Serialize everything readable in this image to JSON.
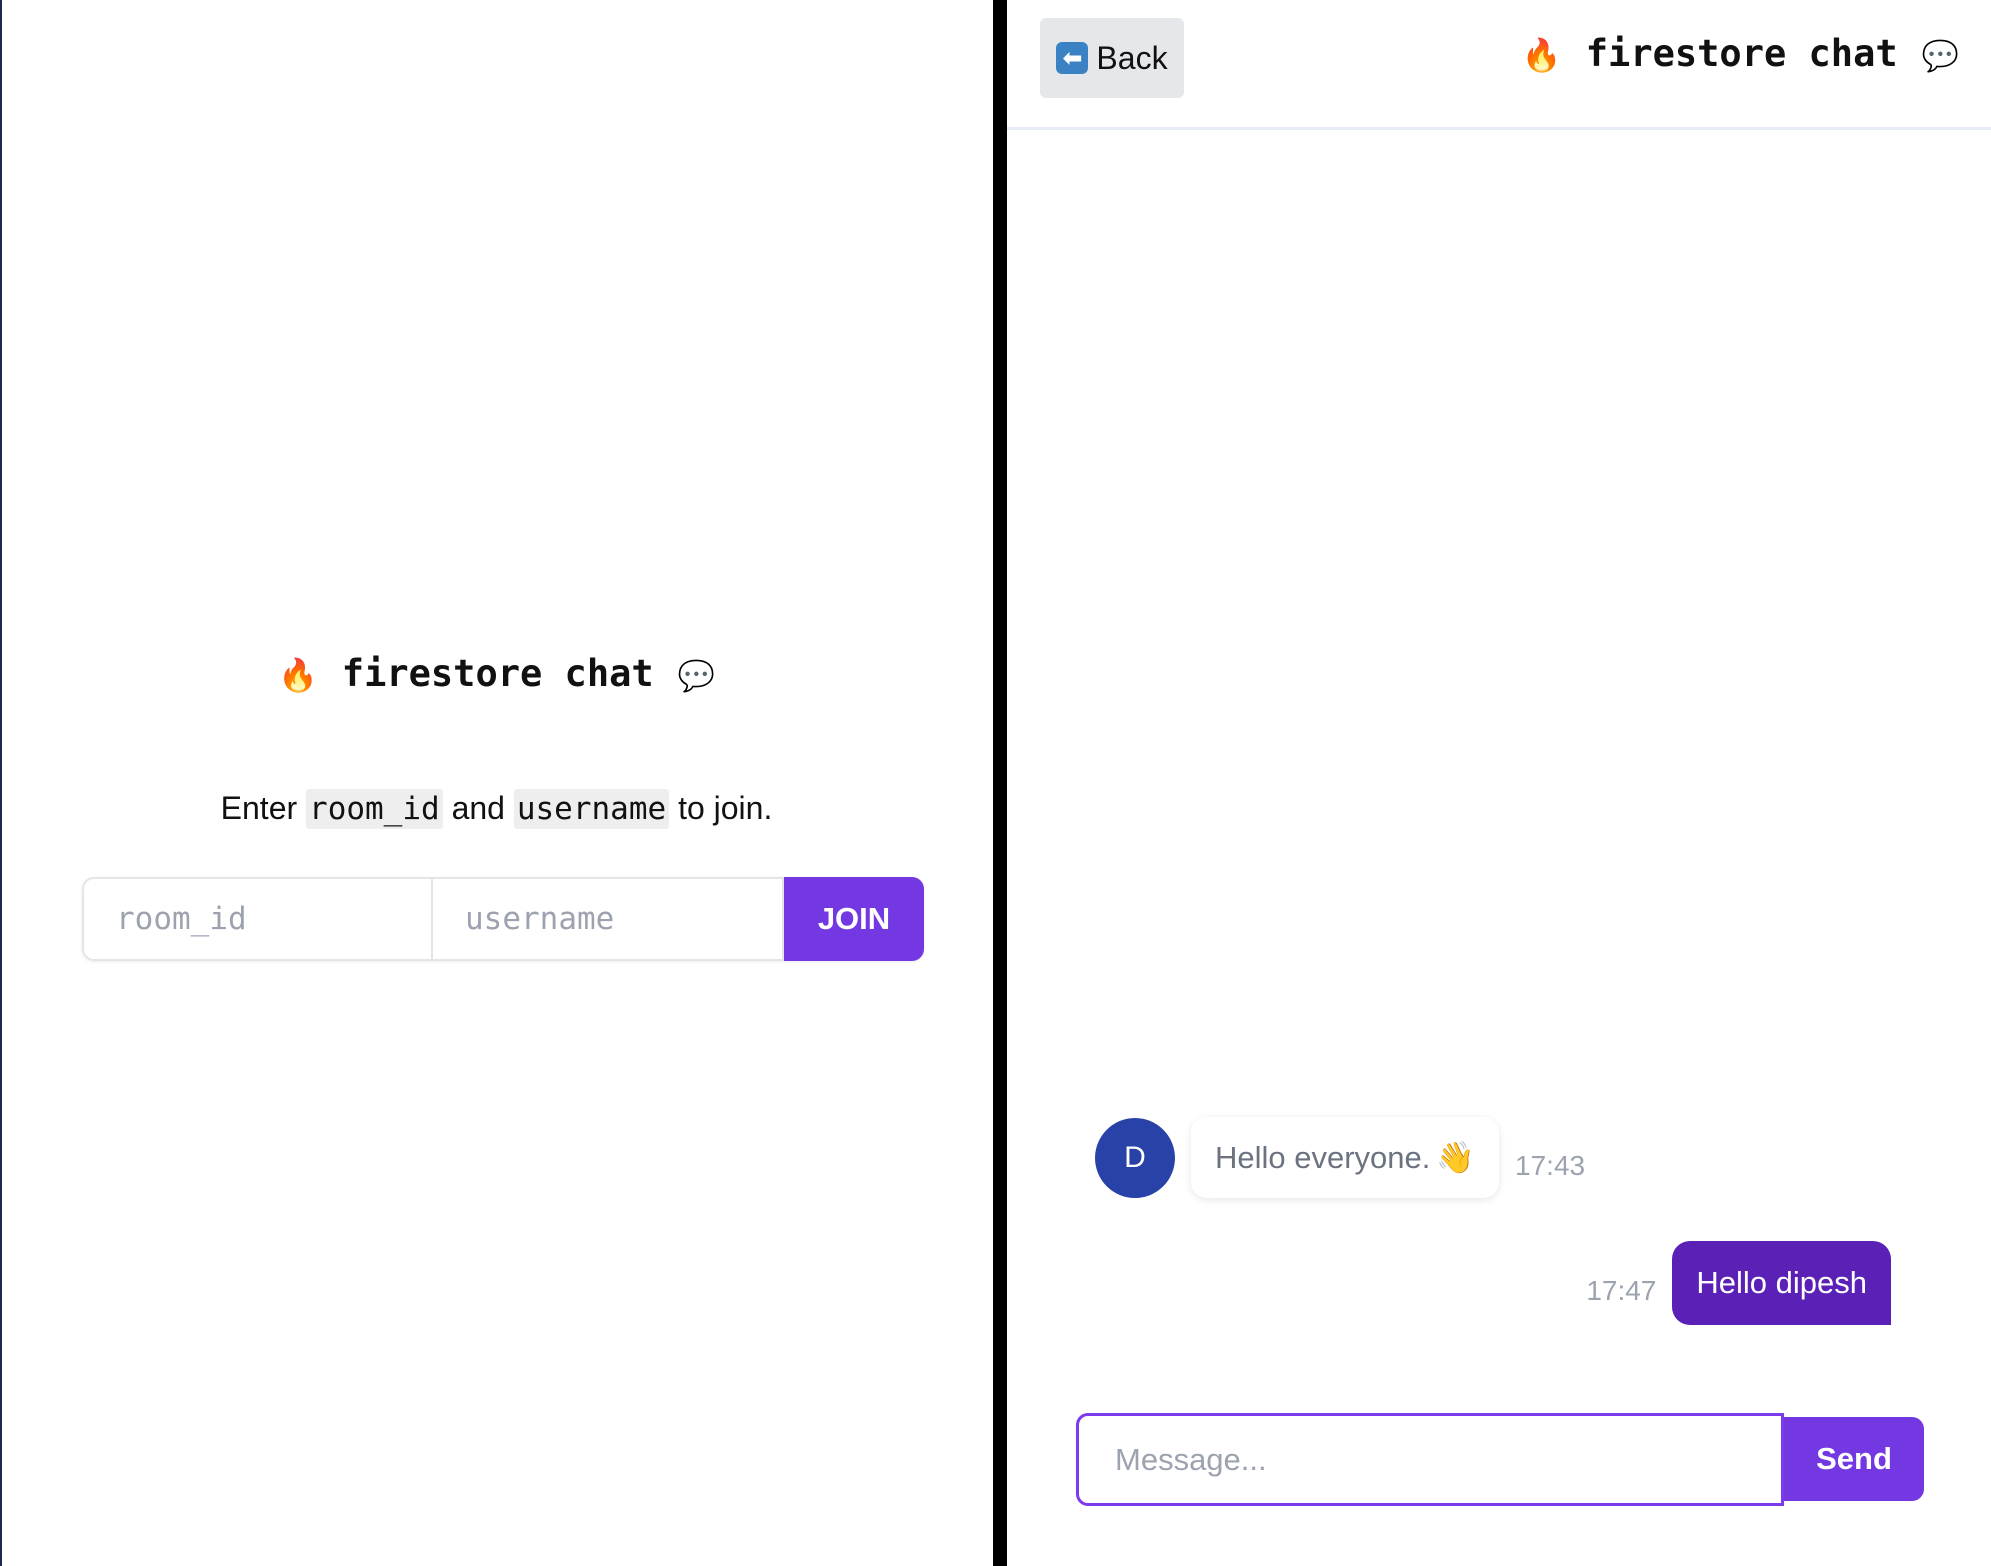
{
  "login": {
    "title": "firestore chat",
    "title_icons": [
      "fire-icon",
      "speech-bubble-icon"
    ],
    "instructions": {
      "prefix": "Enter",
      "code1": "room_id",
      "middle": "and",
      "code2": "username",
      "suffix": "to join."
    },
    "room_placeholder": "room_id",
    "username_placeholder": "username",
    "join_label": "JOIN"
  },
  "chat": {
    "back_label": "Back",
    "title": "firestore chat",
    "messages": [
      {
        "direction": "incoming",
        "avatar_initial": "D",
        "text": "Hello everyone.",
        "emoji": "waving-hand-icon",
        "time": "17:43"
      },
      {
        "direction": "outgoing",
        "text": "Hello dipesh",
        "time": "17:47"
      }
    ],
    "message_placeholder": "Message...",
    "send_label": "Send"
  },
  "colors": {
    "accent": "#7338e2",
    "outgoing_bubble": "#5b21b6",
    "avatar": "#2842a8",
    "divider": "#000000"
  }
}
